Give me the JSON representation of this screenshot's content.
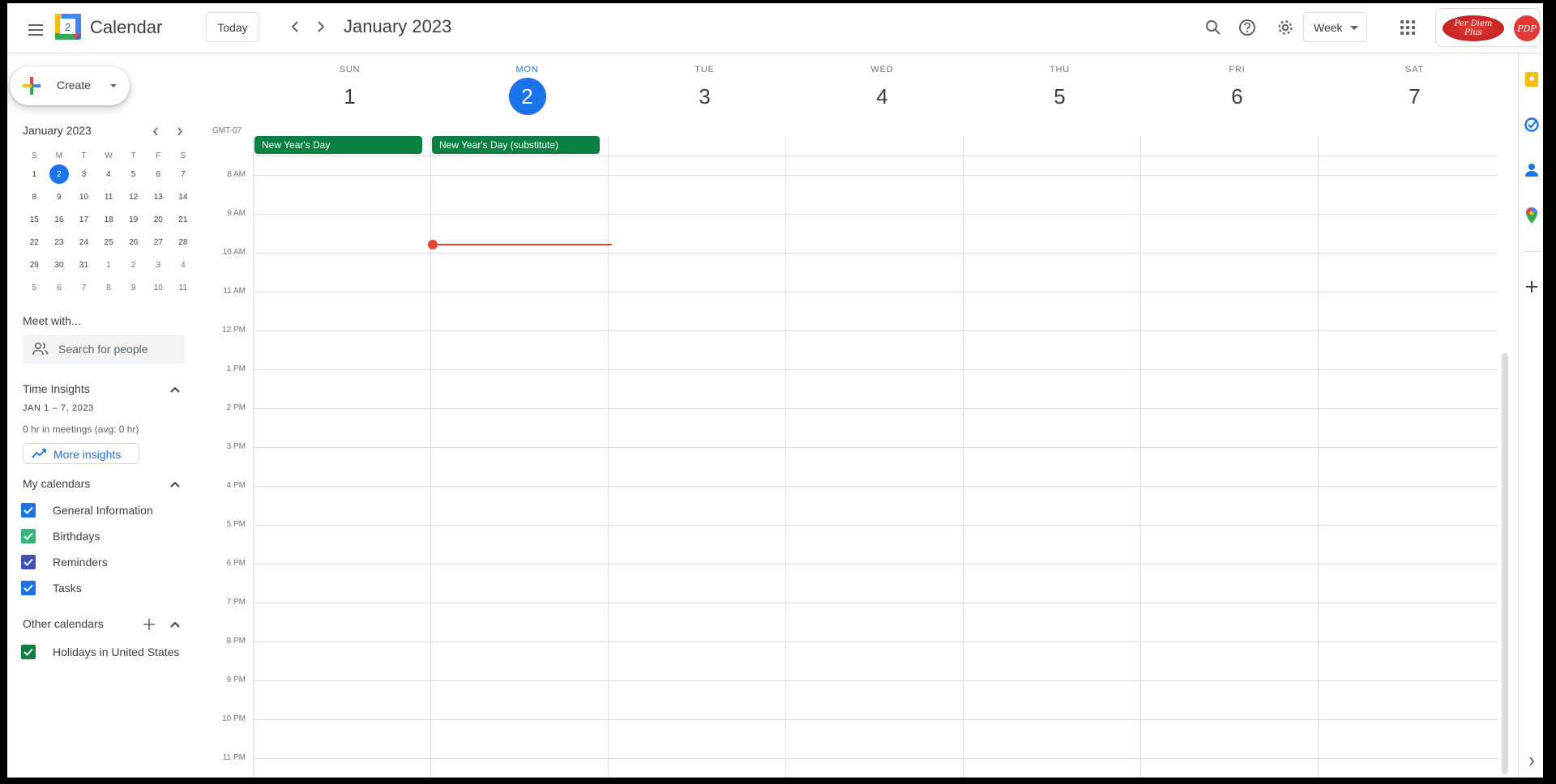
{
  "header": {
    "app_name": "Calendar",
    "logo_date": "2",
    "today_label": "Today",
    "month_title": "January 2023",
    "view_label": "Week",
    "brand_line1": "Per Diem",
    "brand_line2": "Plus",
    "avatar_initials": "PDP"
  },
  "sidebar": {
    "create_label": "Create",
    "mini_calendar": {
      "title": "January 2023",
      "weekdays": [
        "S",
        "M",
        "T",
        "W",
        "T",
        "F",
        "S"
      ],
      "weeks": [
        [
          "1",
          "2",
          "3",
          "4",
          "5",
          "6",
          "7"
        ],
        [
          "8",
          "9",
          "10",
          "11",
          "12",
          "13",
          "14"
        ],
        [
          "15",
          "16",
          "17",
          "18",
          "19",
          "20",
          "21"
        ],
        [
          "22",
          "23",
          "24",
          "25",
          "26",
          "27",
          "28"
        ],
        [
          "29",
          "30",
          "31",
          "1",
          "2",
          "3",
          "4"
        ],
        [
          "5",
          "6",
          "7",
          "8",
          "9",
          "10",
          "11"
        ]
      ]
    },
    "meet_with": {
      "title": "Meet with...",
      "search_placeholder": "Search for people"
    },
    "time_insights": {
      "title": "Time Insights",
      "range": "JAN 1 – 7, 2023",
      "meetings": "0 hr in meetings (avg: 0 hr)",
      "button": "More insights"
    },
    "my_calendars": {
      "title": "My calendars",
      "items": [
        {
          "label": "General Information",
          "color": "#1a73e8"
        },
        {
          "label": "Birthdays",
          "color": "#33b679"
        },
        {
          "label": "Reminders",
          "color": "#3f51b5"
        },
        {
          "label": "Tasks",
          "color": "#1a73e8"
        }
      ]
    },
    "other_calendars": {
      "title": "Other calendars",
      "items": [
        {
          "label": "Holidays in United States",
          "color": "#0b8043"
        }
      ]
    }
  },
  "week": {
    "timezone": "GMT-07",
    "days": [
      {
        "name": "SUN",
        "num": "1"
      },
      {
        "name": "MON",
        "num": "2"
      },
      {
        "name": "TUE",
        "num": "3"
      },
      {
        "name": "WED",
        "num": "4"
      },
      {
        "name": "THU",
        "num": "5"
      },
      {
        "name": "FRI",
        "num": "6"
      },
      {
        "name": "SAT",
        "num": "7"
      }
    ],
    "all_day_events": [
      {
        "title": "New Year's Day",
        "color": "#0b8043"
      },
      {
        "title": "New Year's Day (substitute)",
        "color": "#0b8043"
      }
    ],
    "hours": [
      "8 AM",
      "9 AM",
      "10 AM",
      "11 AM",
      "12 PM",
      "1 PM",
      "2 PM",
      "3 PM",
      "4 PM",
      "5 PM",
      "6 PM",
      "7 PM",
      "8 PM",
      "9 PM",
      "10 PM",
      "11 PM"
    ]
  },
  "colors": {
    "accent": "#1a73e8",
    "now_line": "#ea4335",
    "holiday": "#0b8043"
  }
}
